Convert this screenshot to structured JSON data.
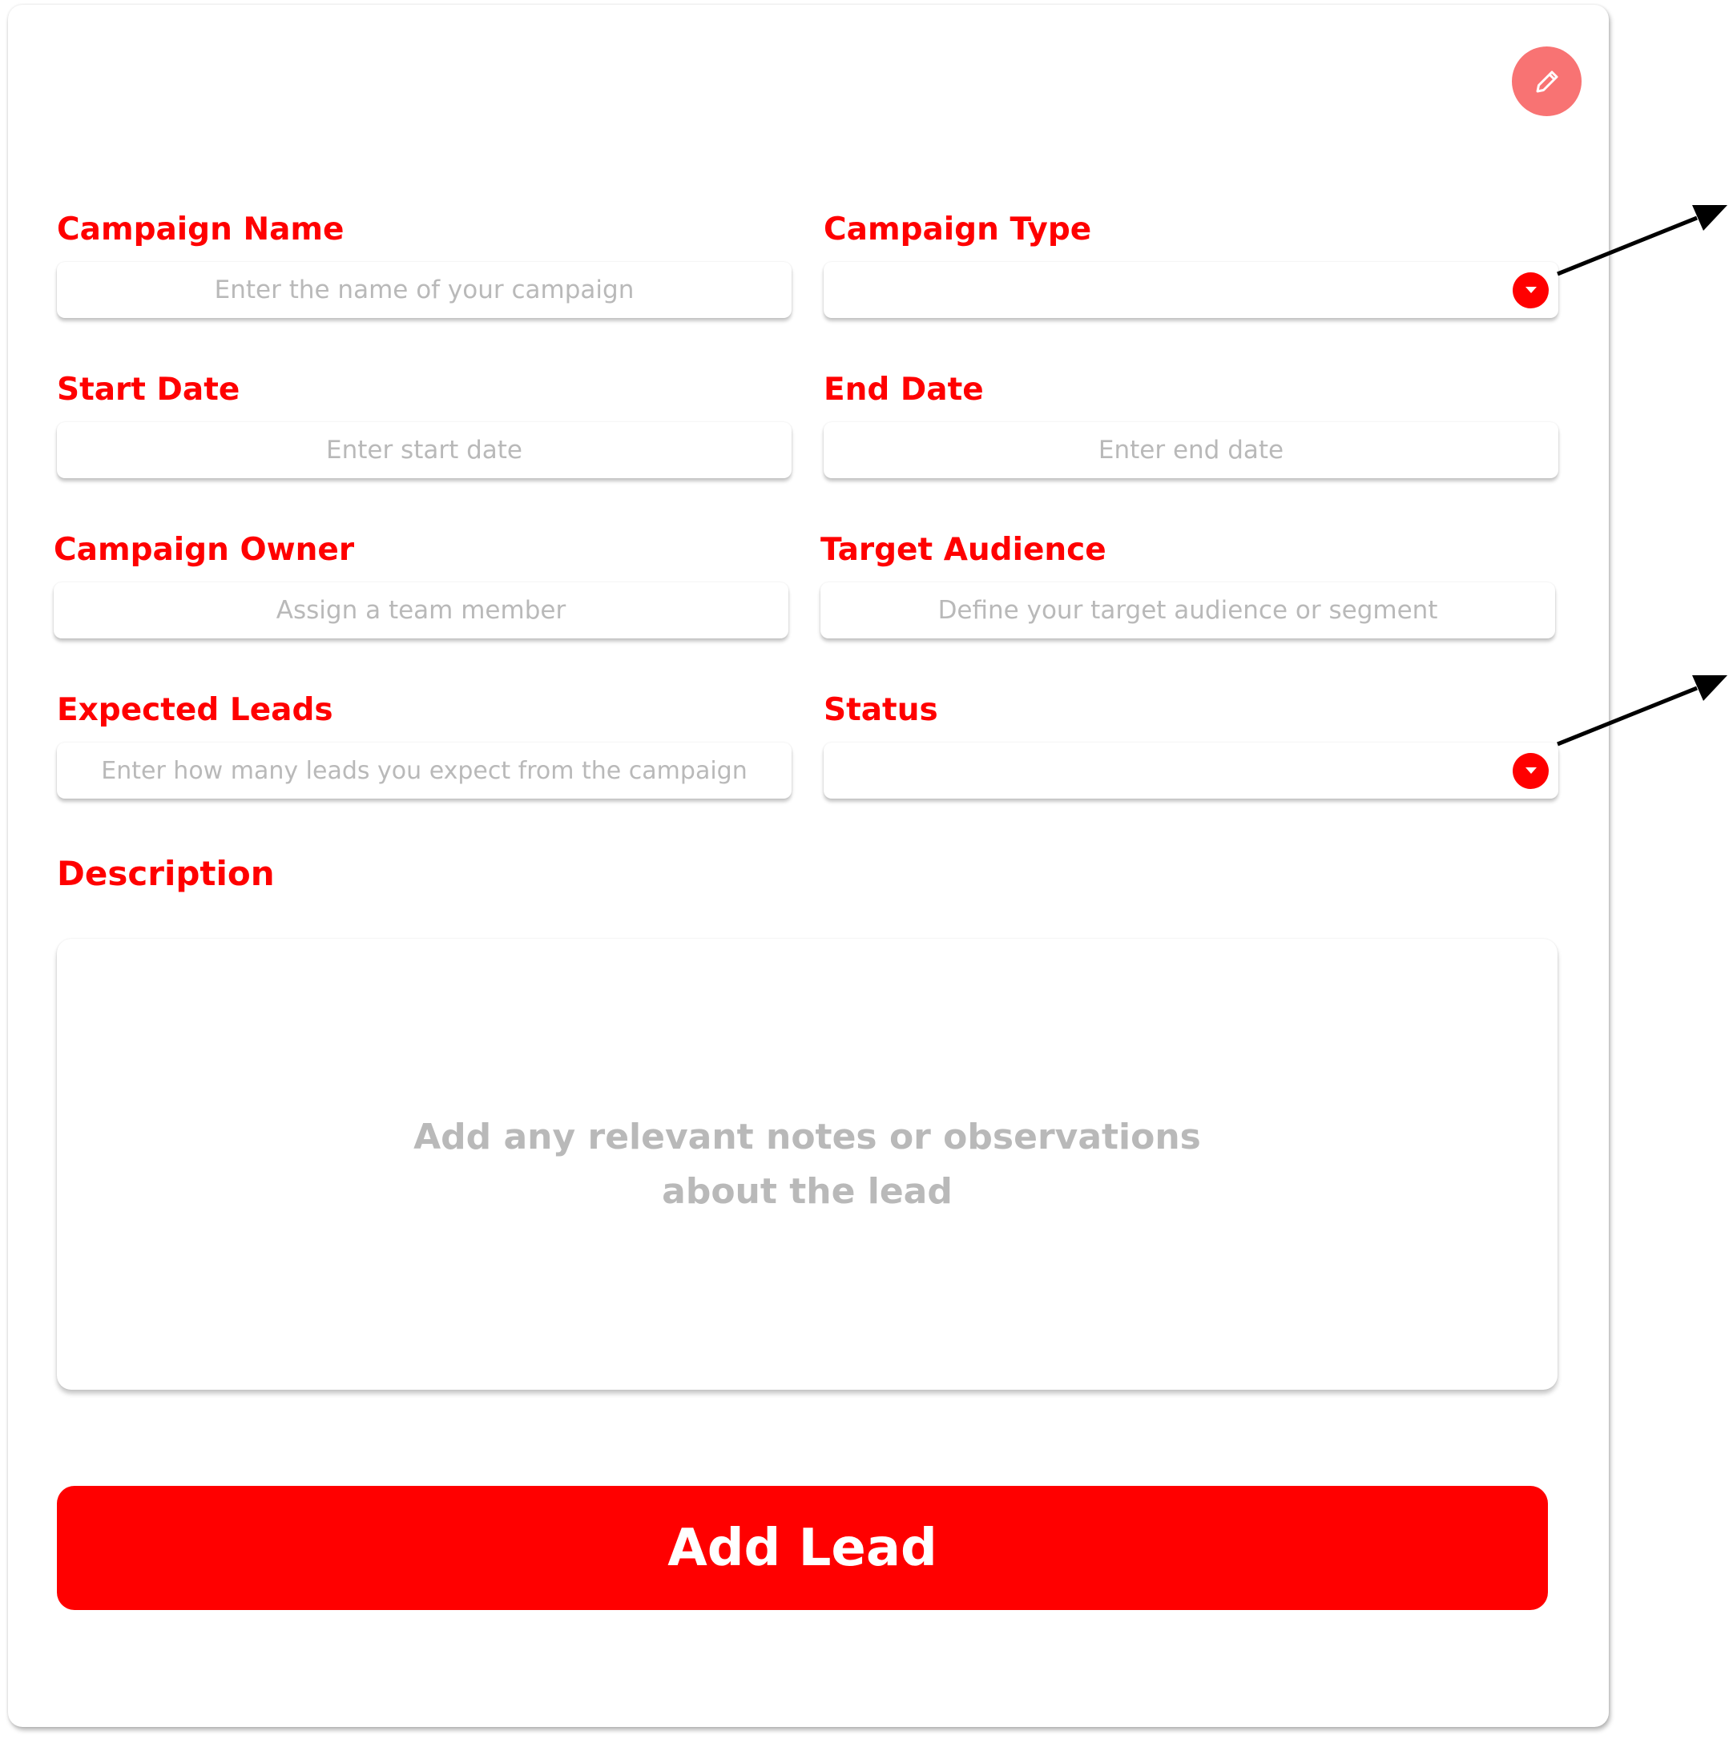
{
  "form": {
    "campaign_name": {
      "label": "Campaign Name",
      "placeholder": "Enter the name of your campaign"
    },
    "campaign_type": {
      "label": "Campaign Type",
      "value": ""
    },
    "start_date": {
      "label": "Start Date",
      "placeholder": "Enter start date"
    },
    "end_date": {
      "label": "End Date",
      "placeholder": "Enter end date"
    },
    "campaign_owner": {
      "label": "Campaign Owner",
      "placeholder": "Assign a team member"
    },
    "target_audience": {
      "label": "Target Audience",
      "placeholder": "Define your target audience or segment"
    },
    "expected_leads": {
      "label": "Expected Leads",
      "placeholder": "Enter how many leads you expect from the campaign"
    },
    "status": {
      "label": "Status",
      "value": ""
    },
    "description": {
      "label": "Description",
      "placeholder": "Add any relevant notes or observations about the lead"
    }
  },
  "actions": {
    "submit_label": "Add Lead"
  },
  "icons": {
    "edit": "pencil-icon",
    "dropdown": "caret-down-icon",
    "annotation": "arrow-icon"
  },
  "colors": {
    "accent": "#ff0000",
    "edit_button": "#f87373",
    "placeholder": "#b9b9b9",
    "label": "#ff0000"
  }
}
